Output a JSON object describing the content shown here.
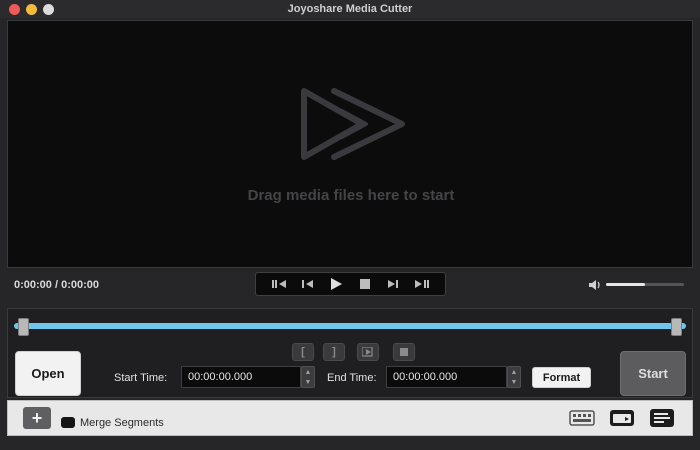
{
  "window": {
    "title": "Joyoshare Media Cutter"
  },
  "player": {
    "drop_text": "Drag media files here to start"
  },
  "transport": {
    "timecode": "0:00:00 / 0:00:00",
    "volume_level": 0.5
  },
  "editor": {
    "open_label": "Open",
    "start_time_label": "Start Time:",
    "start_time_value": "00:00:00.000",
    "end_time_label": "End Time:",
    "end_time_value": "00:00:00.000",
    "format_label": "Format",
    "start_label": "Start",
    "segment_buttons": [
      "[",
      "]"
    ]
  },
  "bottom": {
    "add_label": "+",
    "merge_label": "Merge Segments"
  },
  "colors": {
    "timeline": "#6fc6ef",
    "background": "#262628",
    "player": "#0c0c0d"
  }
}
